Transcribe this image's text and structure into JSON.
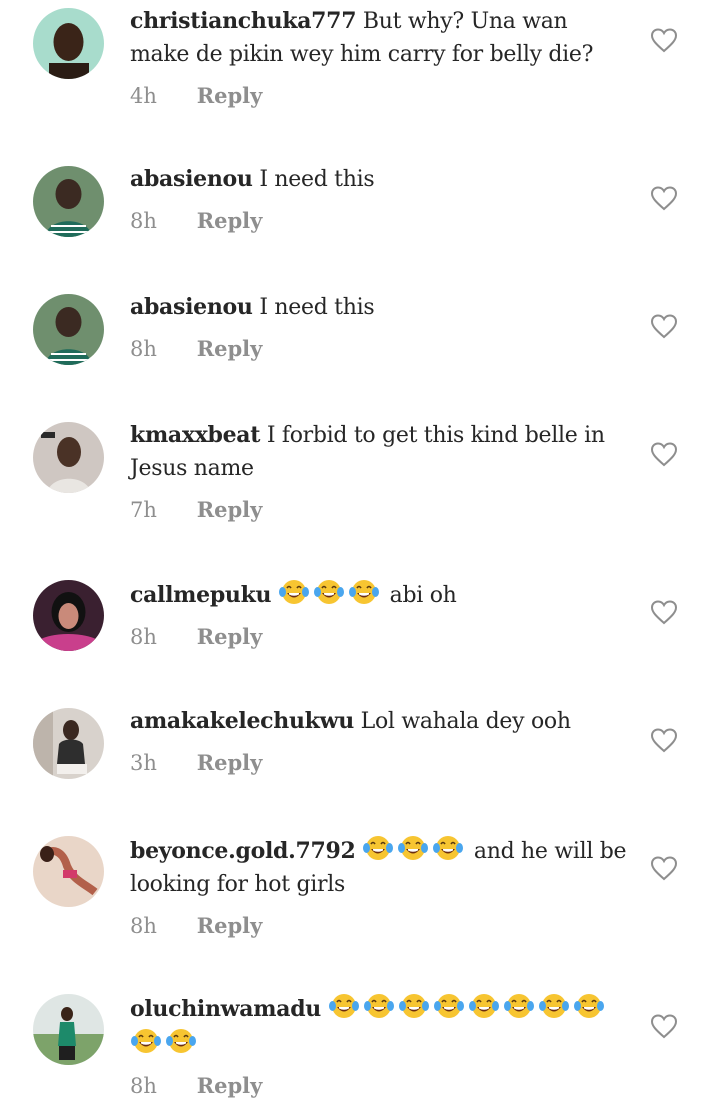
{
  "comments": [
    {
      "username": "christianchuka777",
      "text": "But why? Una wan make de pikin wey him carry for belly die?",
      "time": "4h",
      "reply": "Reply",
      "avatar": "avatar-man-green-bg"
    },
    {
      "username": "abasienou",
      "text": "I need this",
      "time": "8h",
      "reply": "Reply",
      "avatar": "avatar-woman-green"
    },
    {
      "username": "abasienou",
      "text": "I need this",
      "time": "8h",
      "reply": "Reply",
      "avatar": "avatar-woman-green"
    },
    {
      "username": "kmaxxbeat",
      "text": "I forbid to get this kind belle in Jesus name",
      "time": "7h",
      "reply": "Reply",
      "avatar": "avatar-man-selfie"
    },
    {
      "username": "callmepuku",
      "emoji_before": 3,
      "text": "abi oh",
      "time": "8h",
      "reply": "Reply",
      "avatar": "avatar-woman-pink"
    },
    {
      "username": "amakakelechukwu",
      "text": "Lol wahala dey ooh",
      "time": "3h",
      "reply": "Reply",
      "avatar": "avatar-woman-seated"
    },
    {
      "username": "beyonce.gold.7792",
      "emoji_before": 3,
      "text": "and he will be looking for hot girls",
      "time": "8h",
      "reply": "Reply",
      "avatar": "avatar-woman-pose"
    },
    {
      "username": "oluchinwamadu",
      "emoji_before": 10,
      "text": "",
      "time": "8h",
      "reply": "Reply",
      "avatar": "avatar-woman-outdoor"
    }
  ],
  "emoji_name": "face-with-tears-of-joy",
  "like_icon": "heart-outline-icon"
}
